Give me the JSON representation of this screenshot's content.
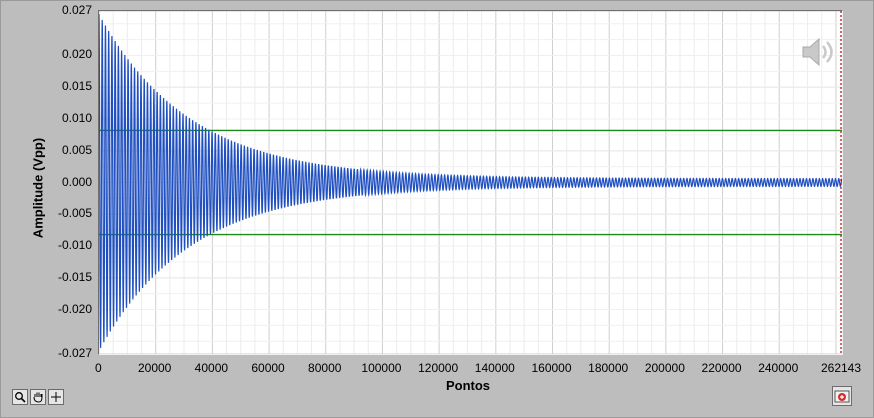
{
  "chart_data": {
    "type": "line",
    "xlabel": "Pontos",
    "ylabel": "Amplitude (Vpp)",
    "xlim": [
      0,
      262143
    ],
    "ylim": [
      -0.027,
      0.027
    ],
    "x_ticks": [
      "0",
      "20000",
      "40000",
      "60000",
      "80000",
      "100000",
      "120000",
      "140000",
      "160000",
      "180000",
      "200000",
      "220000",
      "240000",
      "262143"
    ],
    "y_ticks": [
      "0.027",
      "0.020",
      "0.015",
      "0.010",
      "0.005",
      "0.000",
      "-0.005",
      "-0.010",
      "-0.015",
      "-0.020",
      "-0.027"
    ],
    "grid": true,
    "series": [
      {
        "color": "#1f4fc0",
        "kind": "damped_oscillation",
        "initial_amplitude": 0.0265,
        "decay_points": 32000,
        "final_amplitude": 0.0006,
        "x": [
          0,
          262143
        ]
      }
    ],
    "threshold_lines": [
      {
        "y": 0.0082,
        "color": "#1a8a1a"
      },
      {
        "y": -0.0082,
        "color": "#1a8a1a"
      }
    ],
    "cursor": {
      "x": 262143,
      "color": "#b00000",
      "style": "dotted"
    }
  },
  "palette": {
    "tools": [
      {
        "icon": "zoom-icon",
        "glyph": "🔍"
      },
      {
        "icon": "pan-hand-icon",
        "glyph": "✋"
      },
      {
        "icon": "crosshair-cursor-icon",
        "glyph": "+"
      }
    ]
  },
  "icons": {
    "speaker": "speaker-icon",
    "export": "export-image-icon"
  }
}
